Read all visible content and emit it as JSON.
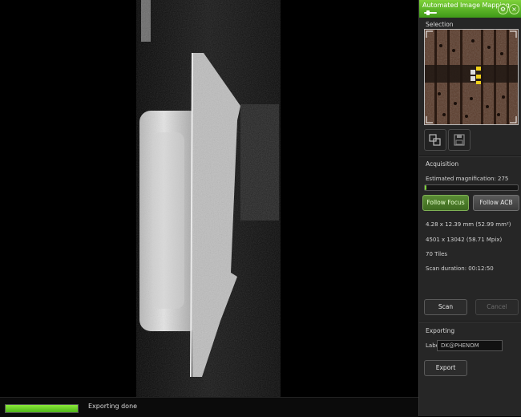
{
  "panel": {
    "title": "Automated Image Mapping",
    "settings_icon": "gear-icon",
    "close_icon": "close-icon",
    "selection": {
      "label": "Selection"
    },
    "tools": [
      {
        "icon": "stitch-tiles-icon"
      },
      {
        "icon": "save-icon"
      }
    ],
    "acquisition": {
      "label": "Acquisition",
      "magnification_label": "Estimated magnification:",
      "magnification_value": "275",
      "magnification_level": 0.02,
      "follow_focus_label": "Follow Focus",
      "follow_acb_label": "Follow ACB",
      "area": "4.28 x 12.39 mm (52.99 mm²)",
      "pixels": "4501 x 13042 (58.71 Mpix)",
      "tiles": "70 Tiles",
      "scan_duration": "Scan duration: 00:12:50",
      "scan_label": "Scan",
      "cancel_label": "Cancel"
    },
    "exporting": {
      "label": "Exporting",
      "field_label": "Label",
      "field_value": "DK@PHENOM",
      "export_label": "Export"
    }
  },
  "status": {
    "progress": 1.0,
    "text": "Exporting done"
  },
  "colors": {
    "accent": "#7ed23a",
    "panel_bg": "#262626",
    "progress_fill": "#6fd42a"
  }
}
